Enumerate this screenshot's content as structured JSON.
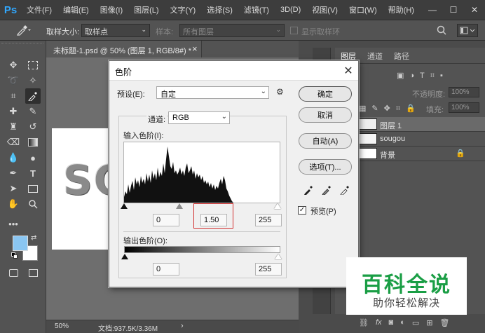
{
  "app": {
    "logo": "Ps"
  },
  "menu": [
    "文件(F)",
    "编辑(E)",
    "图像(I)",
    "图层(L)",
    "文字(Y)",
    "选择(S)",
    "滤镜(T)",
    "3D(D)",
    "视图(V)",
    "窗口(W)",
    "帮助(H)"
  ],
  "window_controls": {
    "minimize": "—",
    "maximize": "☐",
    "close": "✕"
  },
  "options_bar": {
    "sample_size_label": "取样大小:",
    "sample_size_value": "取样点",
    "sample_label": "样本:",
    "sample_value": "所有图层",
    "show_ring_label": "显示取样环"
  },
  "document": {
    "tab_title": "未标题-1.psd @ 50% (图层 1, RGB/8#) *",
    "tab_close": "×",
    "canvas_text": "SO",
    "zoom": "50%",
    "doc_info": "文档:937.5K/3.36M",
    "status_arrow": "›"
  },
  "toolbar": {
    "foreground_color": "#8ac6f2",
    "background_color": "#ffffff"
  },
  "layers_panel": {
    "tabs": [
      "图层",
      "通道",
      "路径"
    ],
    "opacity_label": "不透明度:",
    "opacity_value": "100%",
    "fill_label": "填充:",
    "fill_value": "100%",
    "layers": [
      {
        "name": "图层 1",
        "selected": true
      },
      {
        "name": "sougou",
        "selected": false
      },
      {
        "name": "背景",
        "selected": false,
        "locked": true
      }
    ],
    "bottom_icons": [
      "link-icon",
      "fx-icon",
      "mask-icon",
      "adjustment-icon",
      "folder-icon",
      "new-layer-icon",
      "trash-icon"
    ]
  },
  "levels_dialog": {
    "title": "色阶",
    "close": "✕",
    "preset_label": "预设(E):",
    "preset_value": "自定",
    "channel_label": "通道:",
    "channel_value": "RGB",
    "input_levels_label": "输入色阶(I):",
    "input_black": "0",
    "input_gamma": "1.50",
    "input_white": "255",
    "output_levels_label": "输出色阶(O):",
    "output_black": "0",
    "output_white": "255",
    "buttons": {
      "ok": "确定",
      "cancel": "取消",
      "auto": "自动(A)",
      "options": "选项(T)..."
    },
    "preview_label": "预览(P)",
    "preview_checked": true
  },
  "watermark": {
    "title": "百科全说",
    "subtitle": "助你轻松解决"
  }
}
